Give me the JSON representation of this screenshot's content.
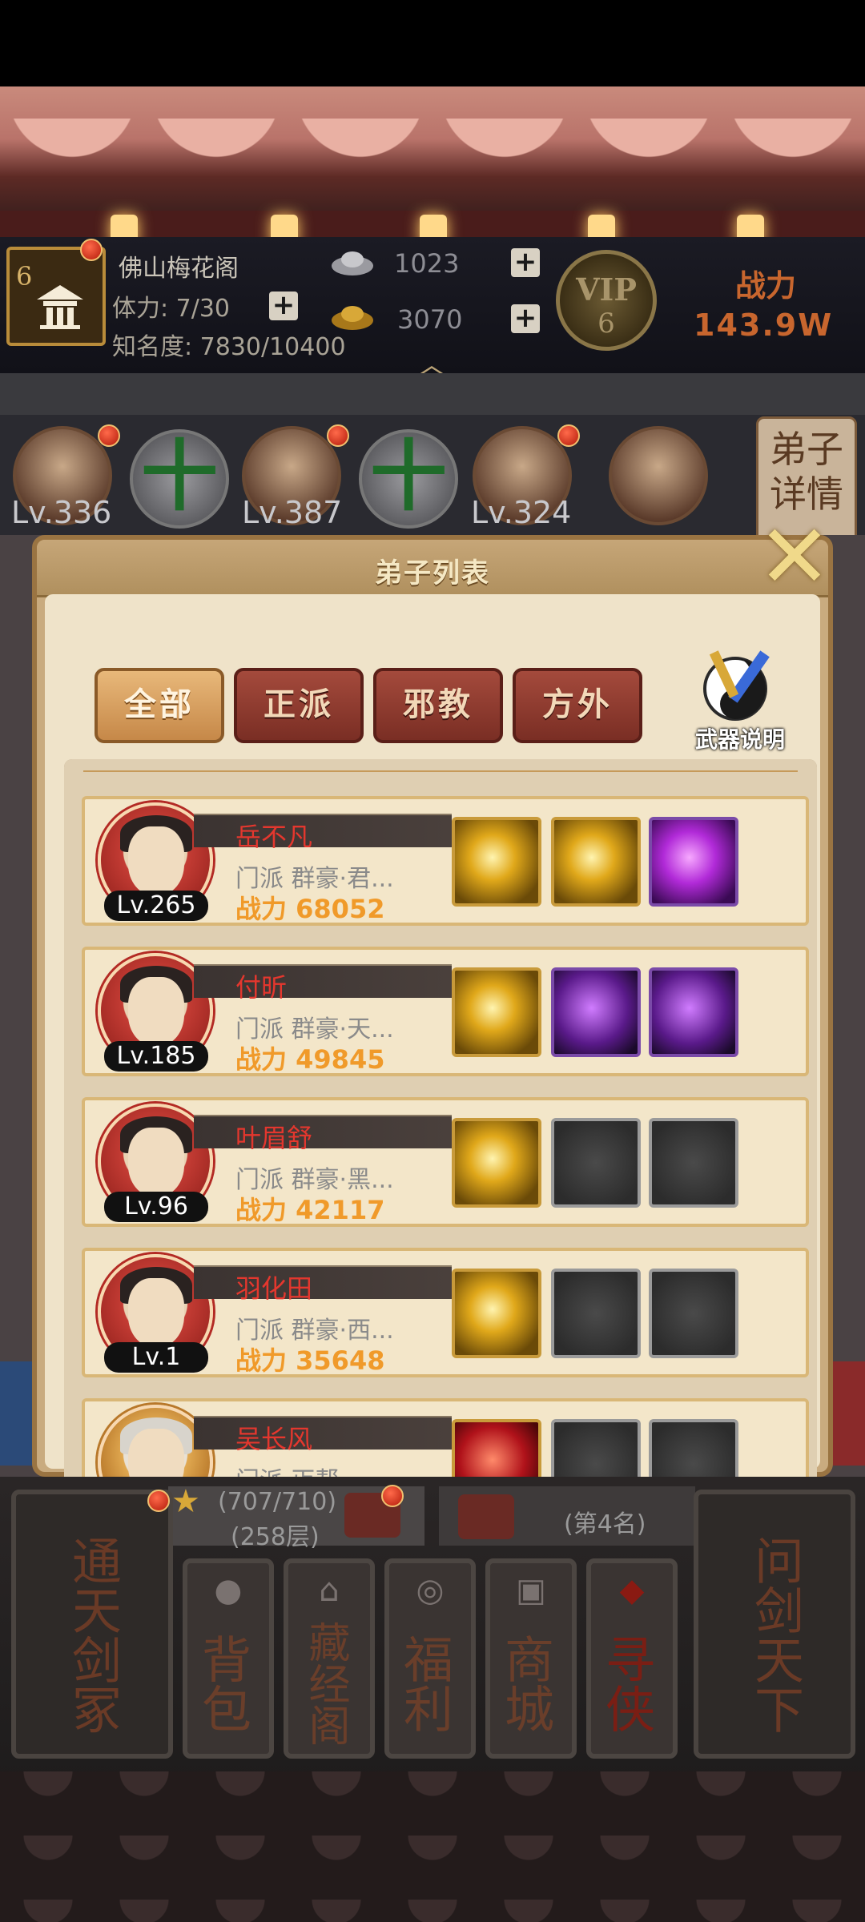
{
  "header": {
    "level_badge": "6",
    "sect_name": "佛山梅花阁",
    "stamina": "体力: 7/30",
    "fame": "知名度: 7830/10400",
    "silver": "1023",
    "gold": "3070",
    "vip_label": "VIP",
    "vip_level": "6",
    "power_label": "战力",
    "power_value": "143.9W"
  },
  "disciple_strip": {
    "levels": [
      "Lv.336",
      "Lv.387",
      "Lv.324"
    ],
    "detail_button": "弟子详情",
    "add_symbol": "十"
  },
  "dialog": {
    "title": "弟子列表",
    "tabs": [
      "全部",
      "正派",
      "邪教",
      "方外"
    ],
    "active_tab": "全部",
    "weapon_button": "武器说明",
    "close_icon": "close-x-icon",
    "disciples": [
      {
        "name": "岳不凡",
        "level": "Lv.265",
        "school": "门派   群豪·君...",
        "power": "战力 68052",
        "skills": [
          "gold",
          "gold",
          "purple"
        ]
      },
      {
        "name": "付昕",
        "level": "Lv.185",
        "school": "门派   群豪·天...",
        "power": "战力 49845",
        "skills": [
          "gold",
          "purple-dark",
          "purple-dark"
        ]
      },
      {
        "name": "叶眉舒",
        "level": "Lv.96",
        "school": "门派   群豪·黑...",
        "power": "战力 42117",
        "skills": [
          "gold",
          "empty",
          "empty"
        ]
      },
      {
        "name": "羽化田",
        "level": "Lv.1",
        "school": "门派   群豪·西...",
        "power": "战力 35648",
        "skills": [
          "gold",
          "empty",
          "empty"
        ]
      },
      {
        "name": "吴长风",
        "level": "",
        "school": "门派   丐帮",
        "power": "",
        "skills": [
          "red",
          "empty",
          "empty"
        ]
      }
    ]
  },
  "bottom": {
    "ladder_score": "(707/710)",
    "ladder_layer": "(258层)",
    "rank": "(第4名)",
    "left_scroll": "通天剑冢",
    "right_scroll": "问剑天下",
    "menu": [
      "背包",
      "藏经阁",
      "福利",
      "商城",
      "寻侠"
    ]
  },
  "colors": {
    "accent_gold": "#d8a838",
    "name_red": "#e4372e",
    "power_orange": "#f09a2a"
  }
}
